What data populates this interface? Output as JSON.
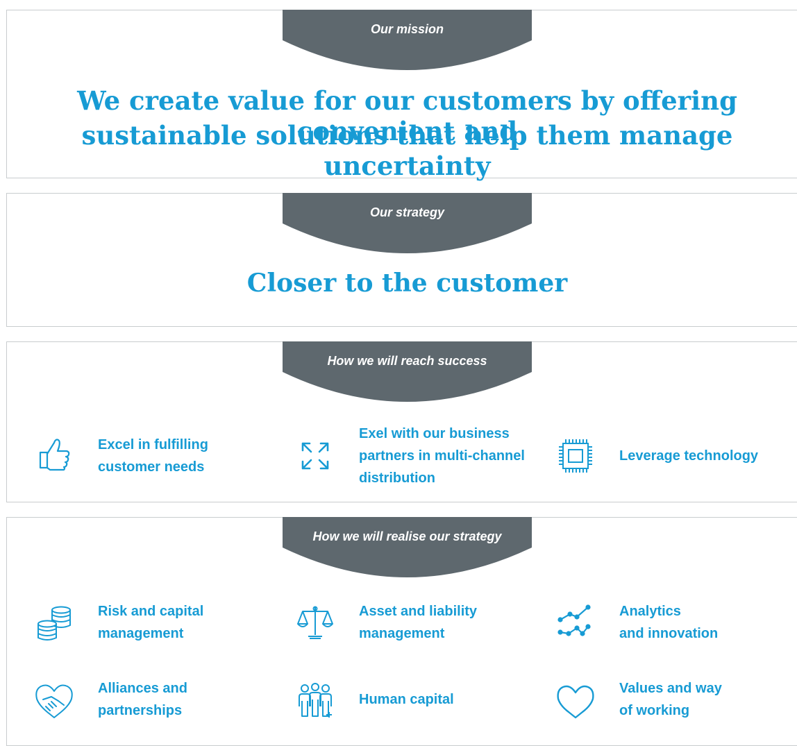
{
  "mission": {
    "tab": "Our mission",
    "line1": "We create value for our customers by offering convenient and",
    "line2": "sustainable solutions that help them manage uncertainty"
  },
  "strategy": {
    "tab": "Our strategy",
    "headline": "Closer to the customer"
  },
  "success": {
    "tab": "How we will reach success",
    "items": [
      {
        "label": "Excel in fulfilling\ncustomer needs",
        "icon": "thumbs-up-icon"
      },
      {
        "label": "Exel with our business\npartners in multi-channel\ndistribution",
        "icon": "expand-arrows-icon"
      },
      {
        "label": "Leverage technology",
        "icon": "chip-icon"
      }
    ]
  },
  "realise": {
    "tab": "How we will realise our strategy",
    "items": [
      {
        "label": "Risk and capital\nmanagement",
        "icon": "coins-stack-icon"
      },
      {
        "label": "Asset and liability\nmanagement",
        "icon": "balance-scale-icon"
      },
      {
        "label": "Analytics\nand innovation",
        "icon": "line-graph-icon"
      },
      {
        "label": "Alliances and\npartnerships",
        "icon": "handshake-heart-icon"
      },
      {
        "label": "Human capital",
        "icon": "people-group-icon"
      },
      {
        "label": "Values and way\nof working",
        "icon": "heart-icon"
      }
    ]
  },
  "colors": {
    "accent": "#179bd4",
    "tab": "#5e686e",
    "border": "#c8ccce"
  }
}
